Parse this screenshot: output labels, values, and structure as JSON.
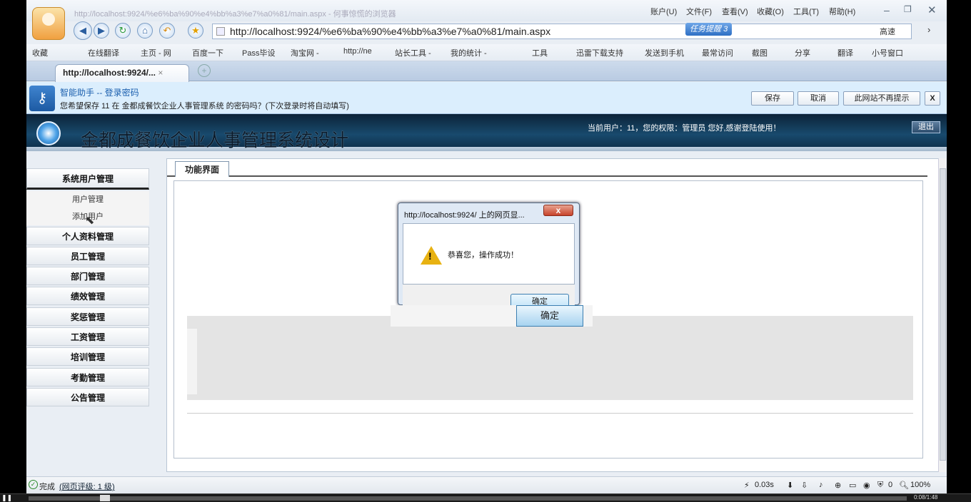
{
  "browser": {
    "window_title": "http://localhost:9924/%e6%ba%90%e4%bb%a3%e7%a0%81/main.aspx - 何事惊慌的浏览器",
    "menu": [
      "账户(U)",
      "文件(F)",
      "查看(V)",
      "收藏(O)",
      "工具(T)",
      "帮助(H)"
    ],
    "url": "http://localhost:9924/%e6%ba%90%e4%bb%a3%e7%a0%81/main.aspx",
    "task_label": "任务提醒",
    "task_count": "3",
    "speed_label": "高速",
    "favorites": [
      "收藏",
      "在线翻译",
      "主页 - 网",
      "百度一下",
      "Pass毕设",
      "淘宝网 -",
      "http://ne",
      "站长工具 -",
      "我的统计 -",
      "工具",
      "迅雷下载支持",
      "发送到手机",
      "最常访问",
      "截图",
      "分享",
      "翻译",
      "小号窗口"
    ],
    "tab_title": "http://localhost:9924/..."
  },
  "notification": {
    "title": "智能助手 -- 登录密码",
    "text": "您希望保存 11 在 金都成餐饮企业人事管理系统 的密码吗？(下次登录时将自动填写)",
    "save": "保存",
    "cancel": "取消",
    "never": "此网站不再提示",
    "close": "X"
  },
  "header": {
    "title": "金都成餐饮企业人事管理系统设计",
    "user_info": "当前用户：11，您的权限：管理员 您好,感谢登陆使用！",
    "logout": "退出"
  },
  "sidebar": {
    "group1": "系统用户管理",
    "sub": [
      "用户管理",
      "添加用户"
    ],
    "groups": [
      "个人资料管理",
      "员工管理",
      "部门管理",
      "绩效管理",
      "奖惩管理",
      "工资管理",
      "培训管理",
      "考勤管理",
      "公告管理"
    ]
  },
  "content": {
    "tab": "功能界面"
  },
  "dialog": {
    "title": "http://localhost:9924/ 上的网页显...",
    "message": "恭喜您，操作成功！",
    "ok": "确定",
    "ok_big": "确定",
    "close": "x"
  },
  "status": {
    "done": "完成",
    "rating": "(网页评级: 1 级)",
    "time": "0.03s",
    "zoom": "100%",
    "count": "0"
  },
  "player": {
    "time": "0:08/1:48"
  },
  "colors": {
    "header_bg": "#184a6d",
    "accent": "#2e6fc4"
  }
}
